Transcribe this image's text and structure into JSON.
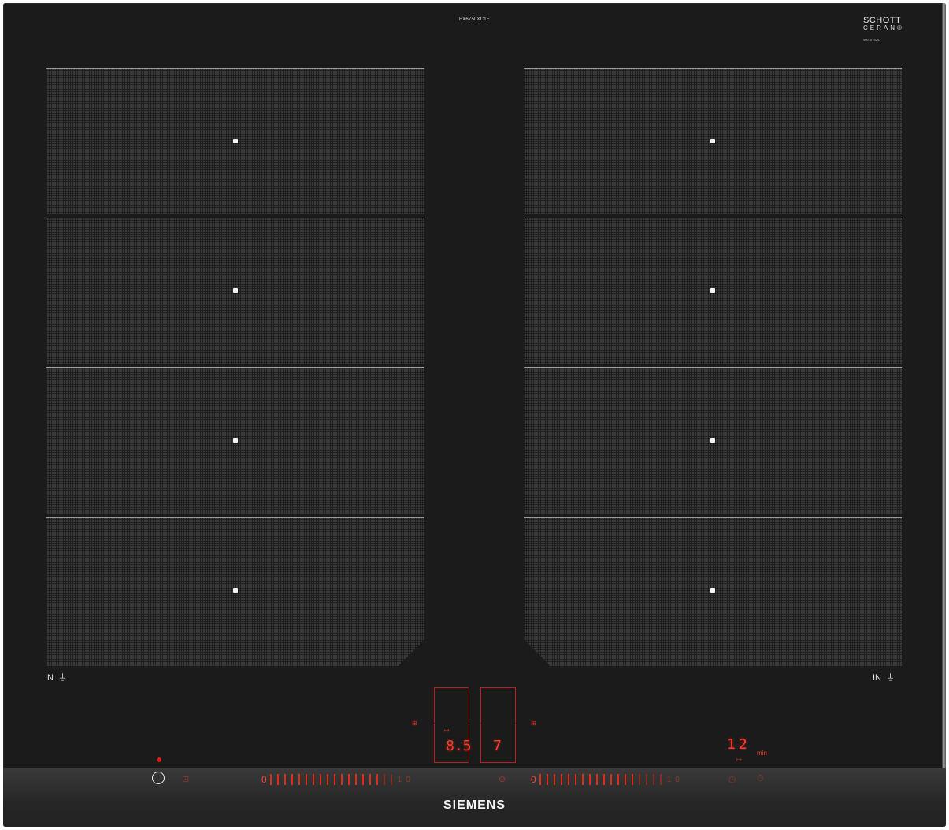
{
  "model_label": "EX675LXC1E",
  "glass_brand": {
    "line1": "SCHOTT",
    "line2": "CERAN®",
    "serial": "9001079247"
  },
  "cooking_zones": {
    "left_label": "IN",
    "right_label": "IN",
    "left_count": 4,
    "right_count": 4
  },
  "displays": {
    "left_power_level": "8.5",
    "right_power_level": "7",
    "timer_value": "12",
    "timer_unit": "min"
  },
  "controls": {
    "slider_start": "0",
    "slider_end": "1 0",
    "power_indicator": "on"
  },
  "brand": "SIEMENS",
  "colors": {
    "glass": "#1b1b1b",
    "zone": "#3a3a3a",
    "display_red": "#ff3a2a"
  },
  "icons": [
    "power-icon",
    "lock-icon",
    "flex-zone-icon",
    "timer-icon",
    "stopwatch-icon",
    "pot-icon"
  ]
}
